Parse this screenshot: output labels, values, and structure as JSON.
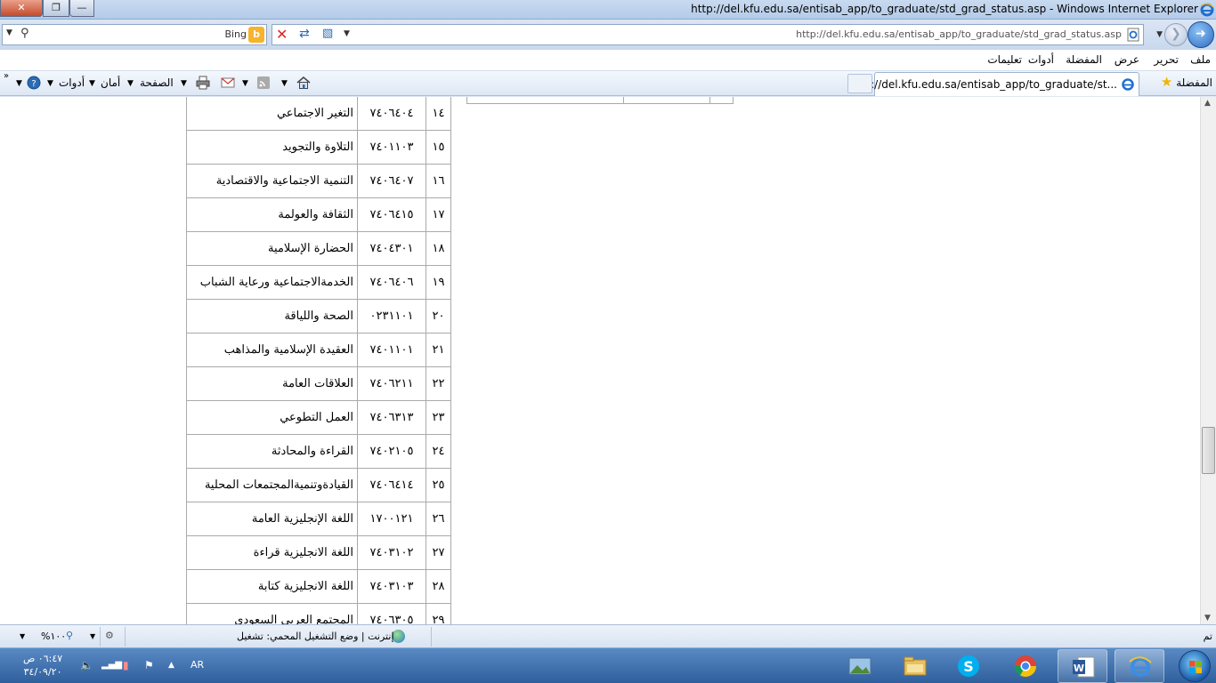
{
  "window": {
    "title": "http://del.kfu.edu.sa/entisab_app/to_graduate/std_grad_status.asp - Windows Internet Explorer",
    "close": "✕",
    "maximize": "❐",
    "minimize": "—"
  },
  "address_bar": {
    "url": "http://del.kfu.edu.sa/entisab_app/to_graduate/std_grad_status.asp",
    "search_provider": "Bing"
  },
  "menu": [
    "ملف",
    "تحرير",
    "عرض",
    "المفضلة",
    "أدوات",
    "تعليمات"
  ],
  "favorites_bar": {
    "favorites_label": "المفضلة",
    "tab_title": "http://del.kfu.edu.sa/entisab_app/to_graduate/st..."
  },
  "command_bar": {
    "page": "الصفحة",
    "safety": "أمان",
    "tools": "أدوات"
  },
  "courses": [
    {
      "num": "١٤",
      "code": "٧٤٠٦٤٠٤",
      "name": "التغير الاجتماعي"
    },
    {
      "num": "١٥",
      "code": "٧٤٠١١٠٣",
      "name": "التلاوة والتجويد"
    },
    {
      "num": "١٦",
      "code": "٧٤٠٦٤٠٧",
      "name": "التنمية الاجتماعية والاقتصادية"
    },
    {
      "num": "١٧",
      "code": "٧٤٠٦٤١٥",
      "name": "الثقافة والعولمة"
    },
    {
      "num": "١٨",
      "code": "٧٤٠٤٣٠١",
      "name": "الحضارة الإسلامية"
    },
    {
      "num": "١٩",
      "code": "٧٤٠٦٤٠٦",
      "name": "الخدمةالاجتماعية ورعاية الشباب"
    },
    {
      "num": "٢٠",
      "code": "٠٢٣١١٠١",
      "name": "الصحة واللياقة"
    },
    {
      "num": "٢١",
      "code": "٧٤٠١١٠١",
      "name": "العقيدة الإسلامية والمذاهب"
    },
    {
      "num": "٢٢",
      "code": "٧٤٠٦٢١١",
      "name": "العلاقات العامة"
    },
    {
      "num": "٢٣",
      "code": "٧٤٠٦٣١٣",
      "name": "العمل التطوعي"
    },
    {
      "num": "٢٤",
      "code": "٧٤٠٢١٠٥",
      "name": "القراءة والمحادثة"
    },
    {
      "num": "٢٥",
      "code": "٧٤٠٦٤١٤",
      "name": "القيادةوتنميةالمجتمعات المحلية"
    },
    {
      "num": "٢٦",
      "code": "١٧٠٠١٢١",
      "name": "اللغة الإنجليزية العامة"
    },
    {
      "num": "٢٧",
      "code": "٧٤٠٣١٠٢",
      "name": "اللغة الانجليزية قراءة"
    },
    {
      "num": "٢٨",
      "code": "٧٤٠٣١٠٣",
      "name": "اللغة الانجليزية كتابة"
    },
    {
      "num": "٢٩",
      "code": "٧٤٠٦٣٠٥",
      "name": "المجتمع العربي السعودي"
    }
  ],
  "status_bar": {
    "done": "تم",
    "zone": "إنترنت | وضع التشغيل المحمي: تشغيل",
    "zoom": "%١٠٠"
  },
  "taskbar": {
    "clock_time": "٠٦:٤٧ ص",
    "clock_date": "٣٤/٠٩/٢٠",
    "language": "AR"
  },
  "icons": {
    "nav_back": "arrow-left-icon",
    "nav_forward": "arrow-right-icon",
    "search": "magnifier-icon",
    "stop": "stop-icon",
    "refresh": "refresh-icon",
    "compatibility": "compatibility-view-icon",
    "favorites": "star-icon",
    "home": "home-icon",
    "feeds": "rss-icon",
    "mail": "mail-icon",
    "print": "printer-icon",
    "help": "help-icon"
  }
}
